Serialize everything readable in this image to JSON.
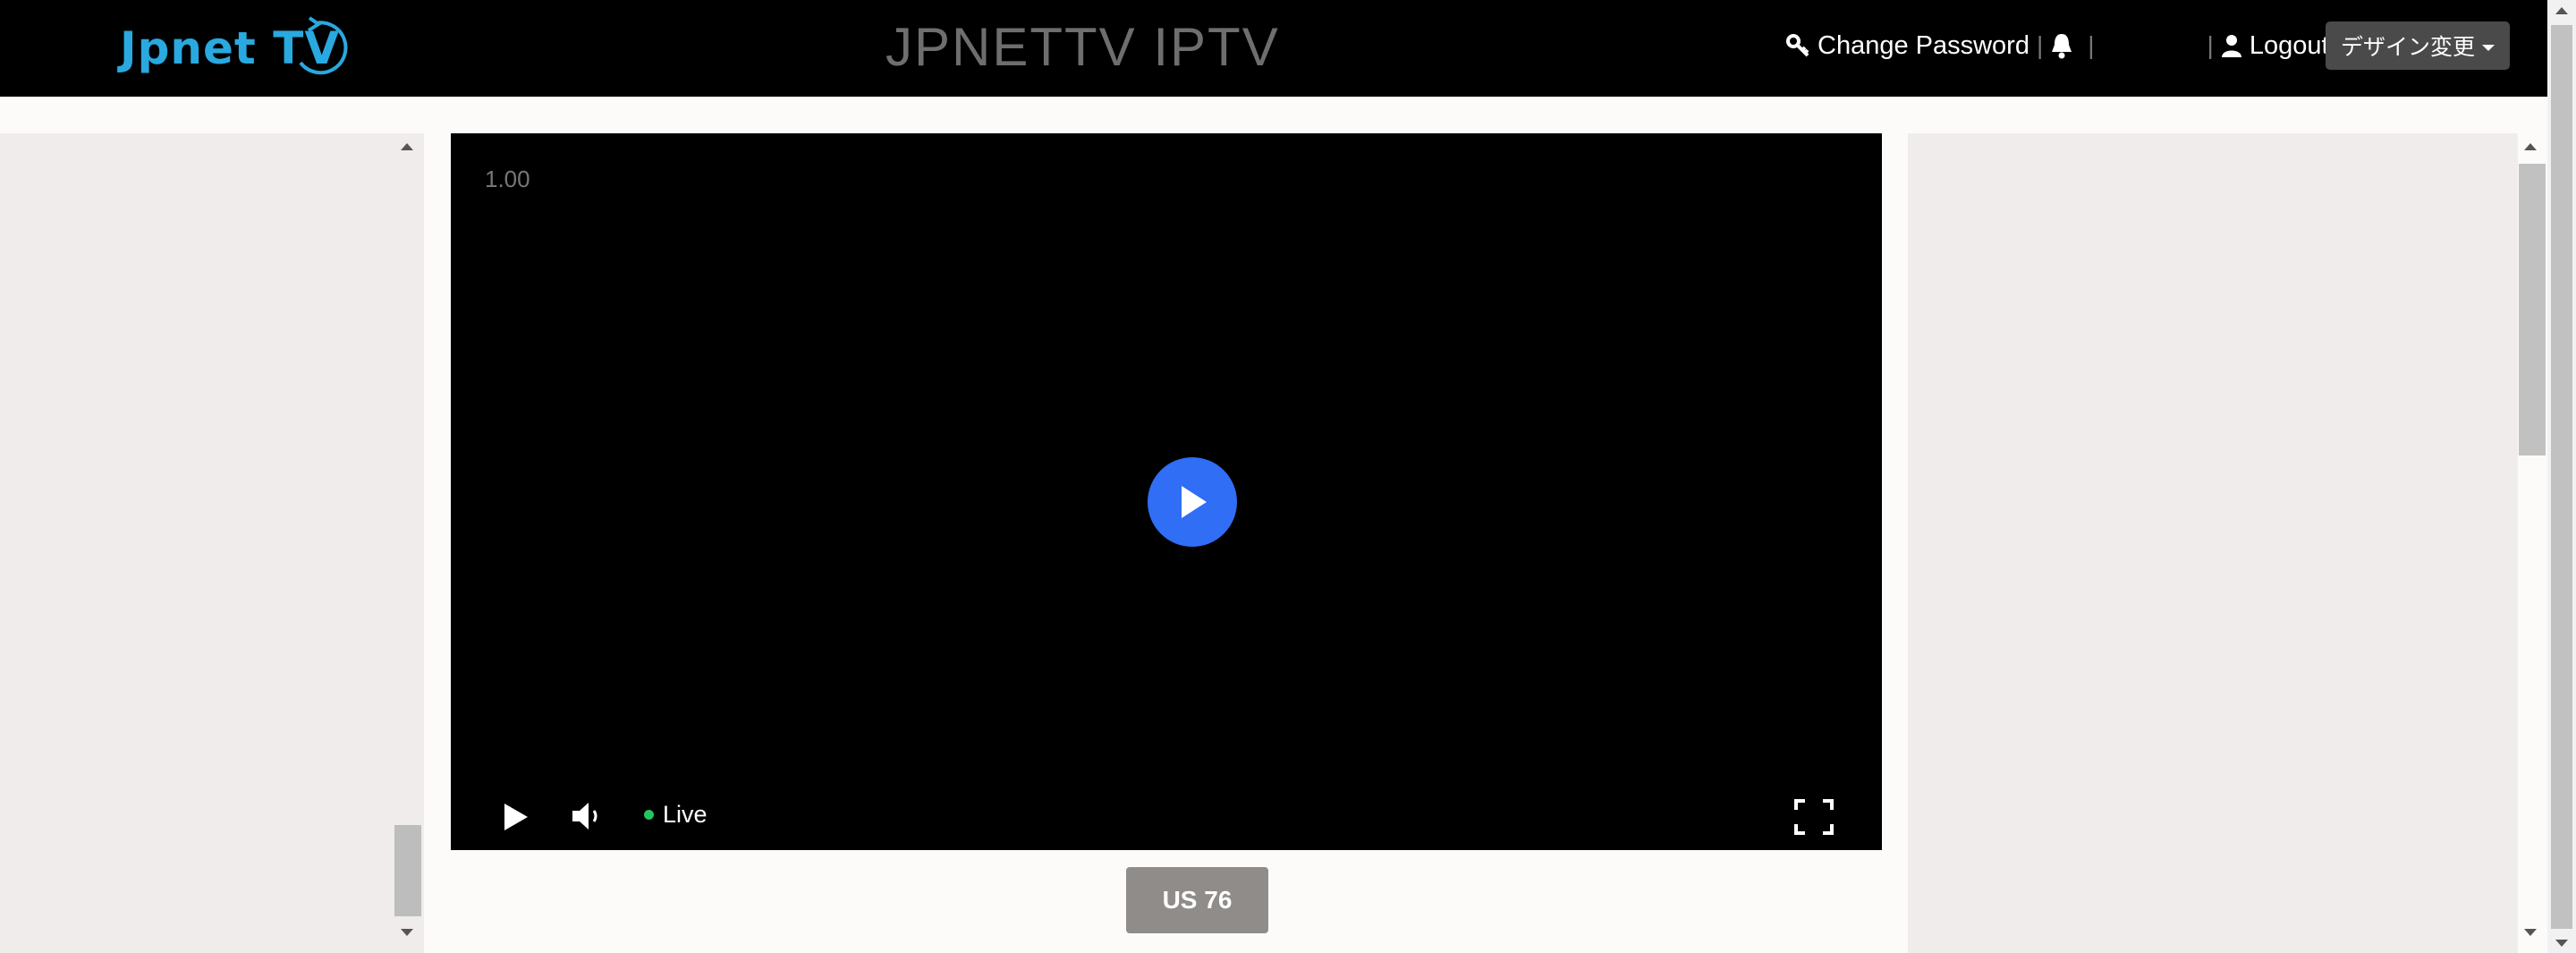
{
  "header": {
    "logo_text": "Jpnet TV",
    "site_title": "JPNETTV IPTV",
    "change_password_label": "Change Password",
    "separator": "|",
    "logout_label": "Logout",
    "design_button_label": "デザイン変更"
  },
  "player": {
    "speed_label": "1.00",
    "live_label": "Live",
    "accent_color": "#2f6ef5",
    "live_dot_color": "#22c55e"
  },
  "channel": {
    "button_label": "US 76"
  },
  "icons": {
    "key": "key-icon",
    "bell": "bell-icon",
    "user": "user-icon",
    "play": "play-icon",
    "volume": "volume-icon",
    "fullscreen": "fullscreen-icon"
  }
}
